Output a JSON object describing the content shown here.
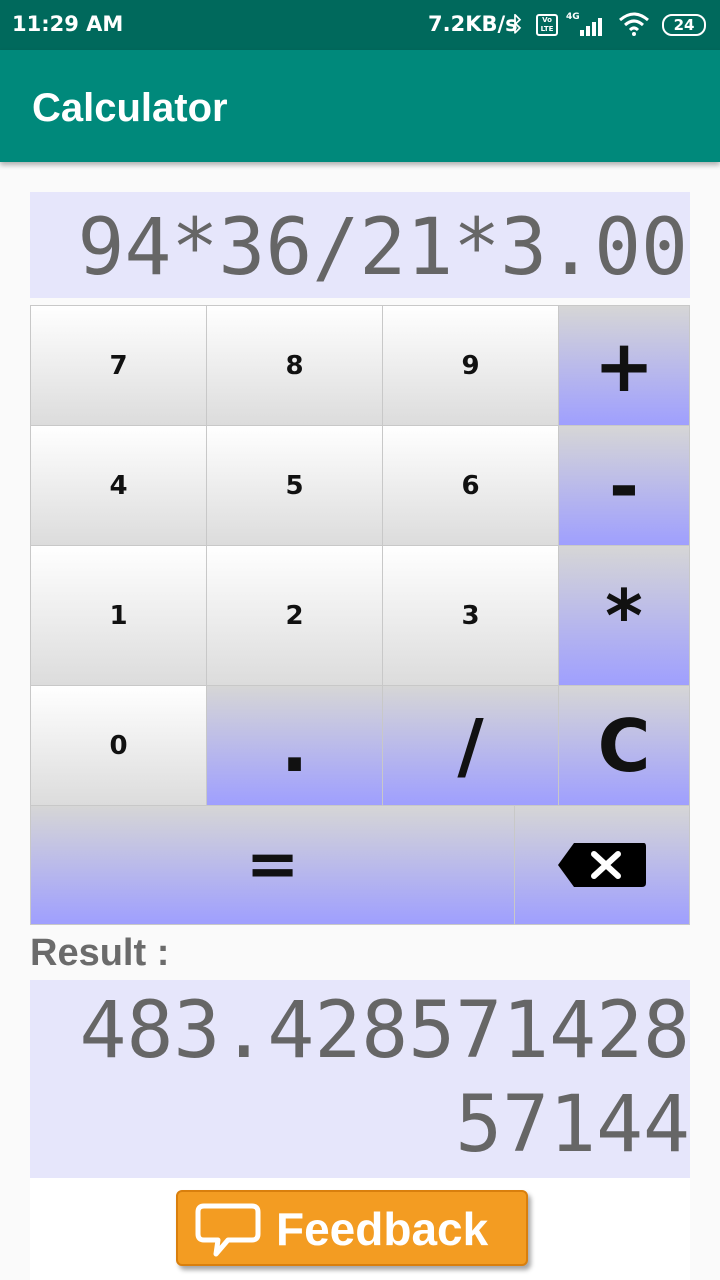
{
  "status_bar": {
    "time": "11:29 AM",
    "network_speed": "7.2KB/s",
    "volte_label": "Vo LTE",
    "network_type": "4G",
    "battery_level": "24"
  },
  "app": {
    "title": "Calculator"
  },
  "display": {
    "expression": "94*36/21*3.00"
  },
  "keypad": {
    "keys": [
      "7",
      "8",
      "9",
      "+",
      "4",
      "5",
      "6",
      "-",
      "1",
      "2",
      "3",
      "*",
      "0",
      ".",
      "/",
      "C",
      "="
    ],
    "backspace_icon": "backspace-icon"
  },
  "result": {
    "label": "Result :",
    "value": "483.42857142857144"
  },
  "feedback": {
    "label": "Feedback",
    "icon": "speech-bubble-icon"
  },
  "colors": {
    "status_bar": "#00695c",
    "app_bar": "#00897b",
    "display_bg": "#e6e6fb",
    "operator_key_bottom": "#9f9ffe",
    "feedback_button": "#f39c22"
  }
}
